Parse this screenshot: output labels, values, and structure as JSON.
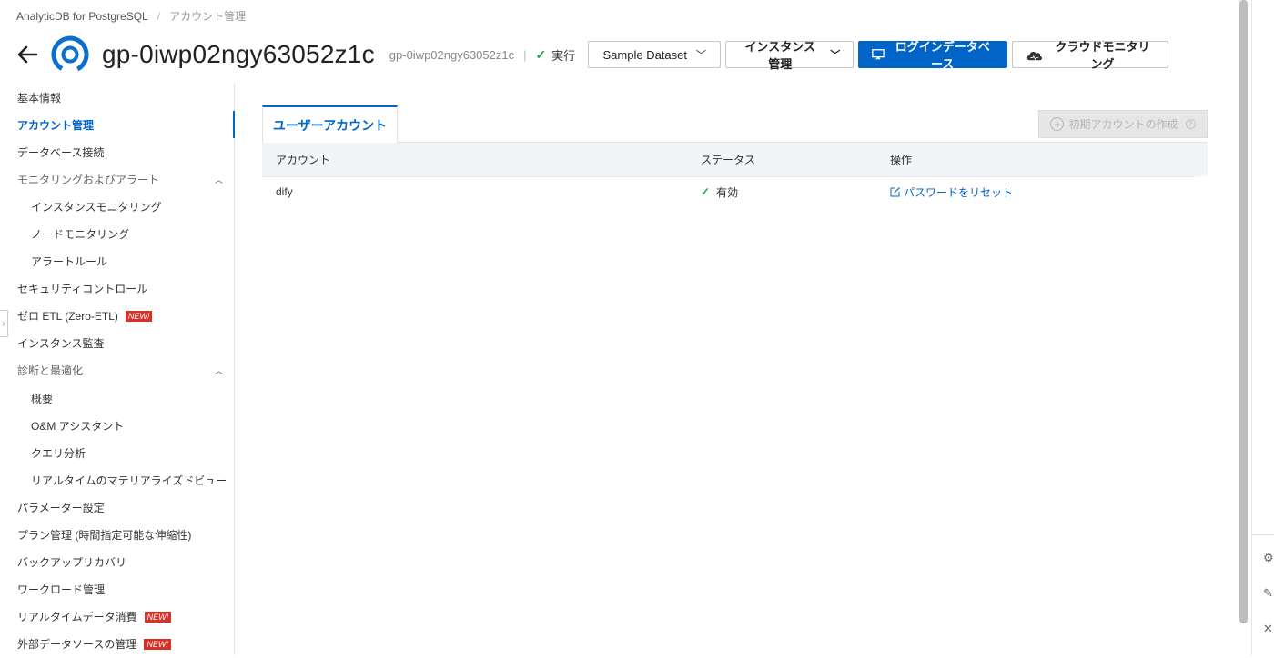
{
  "breadcrumb": {
    "root": "AnalyticDB for PostgreSQL",
    "current": "アカウント管理"
  },
  "header": {
    "title": "gp-0iwp02ngy63052z1c",
    "instance_id": "gp-0iwp02ngy63052z1c",
    "status": "実行",
    "buttons": {
      "sample_dataset": "Sample Dataset",
      "instance_mgmt": "インスタンス管理",
      "login_db": "ログインデータベース",
      "cloud_monitor": "クラウドモニタリング"
    }
  },
  "sidebar": {
    "items": [
      {
        "label": "基本情報"
      },
      {
        "label": "アカウント管理"
      },
      {
        "label": "データベース接続"
      },
      {
        "label": "モニタリングおよびアラート"
      },
      {
        "label": "インスタンスモニタリング"
      },
      {
        "label": "ノードモニタリング"
      },
      {
        "label": "アラートルール"
      },
      {
        "label": "セキュリティコントロール"
      },
      {
        "label": "ゼロ ETL (Zero-ETL)"
      },
      {
        "label": "インスタンス監査"
      },
      {
        "label": "診断と最適化"
      },
      {
        "label": "概要"
      },
      {
        "label": "O&M アシスタント"
      },
      {
        "label": "クエリ分析"
      },
      {
        "label": "リアルタイムのマテリアライズドビュー"
      },
      {
        "label": "パラメーター設定"
      },
      {
        "label": "プラン管理 (時間指定可能な伸縮性)"
      },
      {
        "label": "バックアップリカバリ"
      },
      {
        "label": "ワークロード管理"
      },
      {
        "label": "リアルタイムデータ消費"
      },
      {
        "label": "外部データソースの管理"
      }
    ],
    "new_badge": "NEW!"
  },
  "main": {
    "tab": "ユーザーアカウント",
    "create_button": "初期アカウントの作成",
    "columns": [
      "アカウント",
      "ステータス",
      "操作"
    ],
    "rows": [
      {
        "account": "dify",
        "status": "有効",
        "action": "パスワードをリセット"
      }
    ]
  },
  "colors": {
    "accent": "#0064c8",
    "success": "#1aa64a",
    "badge": "#d93026"
  }
}
